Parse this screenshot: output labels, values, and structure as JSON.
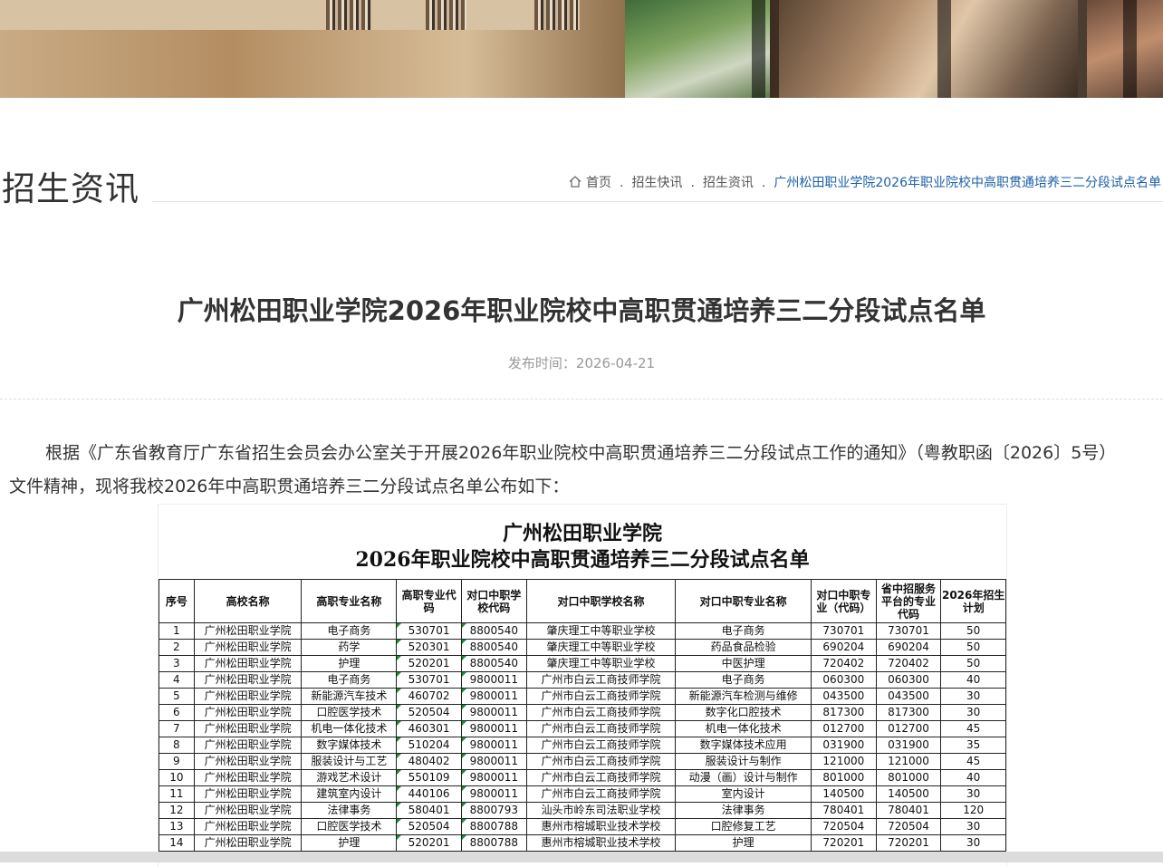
{
  "breadcrumb": {
    "home": "首页",
    "sep": ".",
    "items": [
      "招生快讯",
      "招生资讯"
    ],
    "current": "广州松田职业学院2026年职业院校中高职贯通培养三二分段试点名单"
  },
  "section_title": "招生资讯",
  "article": {
    "title": "广州松田职业学院2026年职业院校中高职贯通培养三二分段试点名单",
    "publish_label": "发布时间：",
    "publish_date": "2026-04-21",
    "intro": "根据《广东省教育厅广东省招生会员会办公室关于开展2026年职业院校中高职贯通培养三二分段试点工作的通知》（粤教职函〔2026〕5号）文件精神，现将我校2026年中高职贯通培养三二分段试点名单公布如下："
  },
  "table": {
    "title_line1": "广州松田职业学院",
    "title_line2": "2026年职业院校中高职贯通培养三二分段试点名单",
    "headers": [
      "序号",
      "高校名称",
      "高职专业名称",
      "高职专业代码",
      "对口中职学校代码",
      "对口中职学校名称",
      "对口中职专业名称",
      "对口中职专业（代码）",
      "省中招服务平台的专业代码",
      "2026年招生计划"
    ],
    "rows": [
      [
        "1",
        "广州松田职业学院",
        "电子商务",
        "530701",
        "8800540",
        "肇庆理工中等职业学校",
        "电子商务",
        "730701",
        "730701",
        "50"
      ],
      [
        "2",
        "广州松田职业学院",
        "药学",
        "520301",
        "8800540",
        "肇庆理工中等职业学校",
        "药品食品检验",
        "690204",
        "690204",
        "50"
      ],
      [
        "3",
        "广州松田职业学院",
        "护理",
        "520201",
        "8800540",
        "肇庆理工中等职业学校",
        "中医护理",
        "720402",
        "720402",
        "50"
      ],
      [
        "4",
        "广州松田职业学院",
        "电子商务",
        "530701",
        "9800011",
        "广州市白云工商技师学院",
        "电子商务",
        "060300",
        "060300",
        "40"
      ],
      [
        "5",
        "广州松田职业学院",
        "新能源汽车技术",
        "460702",
        "9800011",
        "广州市白云工商技师学院",
        "新能源汽车检测与维修",
        "043500",
        "043500",
        "30"
      ],
      [
        "6",
        "广州松田职业学院",
        "口腔医学技术",
        "520504",
        "9800011",
        "广州市白云工商技师学院",
        "数字化口腔技术",
        "817300",
        "817300",
        "30"
      ],
      [
        "7",
        "广州松田职业学院",
        "机电一体化技术",
        "460301",
        "9800011",
        "广州市白云工商技师学院",
        "机电一体化技术",
        "012700",
        "012700",
        "45"
      ],
      [
        "8",
        "广州松田职业学院",
        "数字媒体技术",
        "510204",
        "9800011",
        "广州市白云工商技师学院",
        "数字媒体技术应用",
        "031900",
        "031900",
        "35"
      ],
      [
        "9",
        "广州松田职业学院",
        "服装设计与工艺",
        "480402",
        "9800011",
        "广州市白云工商技师学院",
        "服装设计与制作",
        "121000",
        "121000",
        "45"
      ],
      [
        "10",
        "广州松田职业学院",
        "游戏艺术设计",
        "550109",
        "9800011",
        "广州市白云工商技师学院",
        "动漫（画）设计与制作",
        "801000",
        "801000",
        "40"
      ],
      [
        "11",
        "广州松田职业学院",
        "建筑室内设计",
        "440106",
        "9800011",
        "广州市白云工商技师学院",
        "室内设计",
        "140500",
        "140500",
        "30"
      ],
      [
        "12",
        "广州松田职业学院",
        "法律事务",
        "580401",
        "8800793",
        "汕头市岭东司法职业学校",
        "法律事务",
        "780401",
        "780401",
        "120"
      ],
      [
        "13",
        "广州松田职业学院",
        "口腔医学技术",
        "520504",
        "8800788",
        "惠州市榕城职业技术学校",
        "口腔修复工艺",
        "720504",
        "720504",
        "30"
      ],
      [
        "14",
        "广州松田职业学院",
        "护理",
        "520201",
        "8800788",
        "惠州市榕城职业技术学校",
        "护理",
        "720201",
        "720201",
        "30"
      ]
    ]
  },
  "icons": {
    "home": "home-icon"
  },
  "colors": {
    "breadcrumb_current": "#1b5fa8",
    "code_marker": "#1e8a3c"
  }
}
